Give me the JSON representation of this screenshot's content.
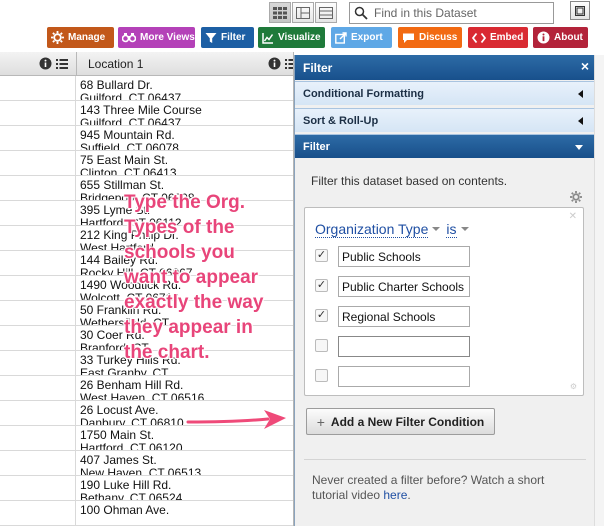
{
  "search": {
    "placeholder": "Find in this Dataset"
  },
  "toolbar": {
    "manage": "Manage",
    "more_views": "More Views",
    "filter": "Filter",
    "visualize": "Visualize",
    "export": "Export",
    "discuss": "Discuss",
    "embed": "Embed",
    "about": "About"
  },
  "colors": {
    "manage": "#c2581a",
    "more_views": "#b441b8",
    "filter": "#1d5fa4",
    "visualize": "#1f7a3a",
    "export": "#5fa8e6",
    "discuss": "#f26a12",
    "embed": "#d92a32",
    "about": "#b3233a",
    "annotation": "#e8457a"
  },
  "grid": {
    "column_header": "Location 1",
    "rows": [
      {
        "line1": "68 Bullard Dr.",
        "line2": "Guilford, CT 06437"
      },
      {
        "line1": "143 Three Mile Course",
        "line2": "Guilford, CT 06437"
      },
      {
        "line1": "945 Mountain Rd.",
        "line2": "Suffield, CT 06078"
      },
      {
        "line1": "75 East Main St.",
        "line2": "Clinton, CT 06413"
      },
      {
        "line1": "655 Stillman St.",
        "line2": "Bridgeport, CT 06608"
      },
      {
        "line1": "395 Lyme St.",
        "line2": "Hartford, CT 06112"
      },
      {
        "line1": "212 King Philip Dr.",
        "line2": "West Hartford"
      },
      {
        "line1": "144 Bailey Rd.",
        "line2": "Rocky Hill, CT 06067"
      },
      {
        "line1": "1490 Woodtick Rd.",
        "line2": "Wolcott, CT 06716"
      },
      {
        "line1": "50 Franklin Rd.",
        "line2": "Wethersfield, CT"
      },
      {
        "line1": "30 Coer Rd.",
        "line2": "Branford, CT"
      },
      {
        "line1": "33 Turkey Hills Rd.",
        "line2": "East Granby, CT"
      },
      {
        "line1": "26 Benham Hill Rd.",
        "line2": "West Haven, CT 06516"
      },
      {
        "line1": "26 Locust Ave.",
        "line2": "Danbury, CT 06810"
      },
      {
        "line1": "1750 Main St.",
        "line2": "Hartford, CT 06120"
      },
      {
        "line1": "407 James St.",
        "line2": "New Haven, CT 06513"
      },
      {
        "line1": "190 Luke Hill Rd.",
        "line2": "Bethany, CT 06524"
      },
      {
        "line1": "100 Ohman Ave.",
        "line2": ""
      }
    ]
  },
  "panel": {
    "title": "Filter",
    "close": "×",
    "sections": {
      "conditional_formatting": "Conditional Formatting",
      "sort_rollup": "Sort & Roll-Up",
      "filter": "Filter"
    },
    "description": "Filter this dataset based on contents.",
    "condition": {
      "column": "Organization Type",
      "operator": "is",
      "values": [
        "Public Schools",
        "Public Charter Schools",
        "Regional Schools",
        "",
        ""
      ],
      "checked": [
        true,
        true,
        true,
        false,
        false
      ]
    },
    "add_button": "Add a New Filter Condition",
    "help_text": "Never created a filter before? Watch a short tutorial video ",
    "help_link": "here",
    "help_end": "."
  },
  "annotation": "Type the Org.\nTypes of the\nschools you\nwant to appear\nexactly the way\nthey appear in\nthe chart."
}
